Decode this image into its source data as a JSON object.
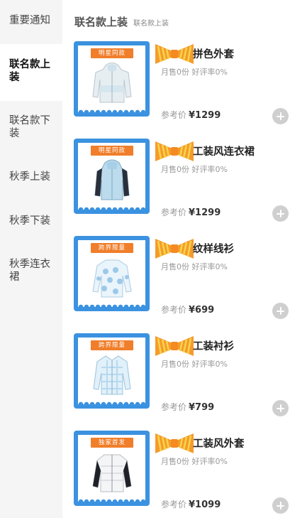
{
  "sidebar": {
    "items": [
      {
        "label": "重要通知",
        "active": false
      },
      {
        "label": "联名款上装",
        "active": true
      },
      {
        "label": "联名款下装",
        "active": false
      },
      {
        "label": "秋季上装",
        "active": false
      },
      {
        "label": "秋季下装",
        "active": false
      },
      {
        "label": "秋季连衣裙",
        "active": false
      }
    ]
  },
  "header": {
    "title": "联名款上装",
    "subtitle": "联名款上装"
  },
  "products": [
    {
      "badge": "明星同款",
      "name": "拼色外套",
      "monthly_sales": "月售0份",
      "rating": "好评率0%",
      "price_label": "参考价",
      "price": "¥1299",
      "image": "hooded-jacket-icon"
    },
    {
      "badge": "明星同款",
      "name": "工装风连衣裙",
      "monthly_sales": "月售0份",
      "rating": "好评率0%",
      "price_label": "参考价",
      "price": "¥1299",
      "image": "hooded-coat-icon"
    },
    {
      "badge": "跨界限量",
      "name": "纹样线衫",
      "monthly_sales": "月售0份",
      "rating": "好评率0%",
      "price_label": "参考价",
      "price": "¥699",
      "image": "patterned-sweater-icon"
    },
    {
      "badge": "跨界限量",
      "name": "工装衬衫",
      "monthly_sales": "月售0份",
      "rating": "好评率0%",
      "price_label": "参考价",
      "price": "¥799",
      "image": "patterned-shirt-icon"
    },
    {
      "badge": "独家首发",
      "name": "工装风外套",
      "monthly_sales": "月售0份",
      "rating": "好评率0%",
      "price_label": "参考价",
      "price": "¥1099",
      "image": "puffer-jacket-icon"
    }
  ],
  "colors": {
    "accent_blue": "#3b92e0",
    "badge_orange": "#f07e2a",
    "bow_orange": "#f59b2c",
    "bow_yellow": "#f7d54a",
    "add_button_gray": "#cfcfcf"
  }
}
